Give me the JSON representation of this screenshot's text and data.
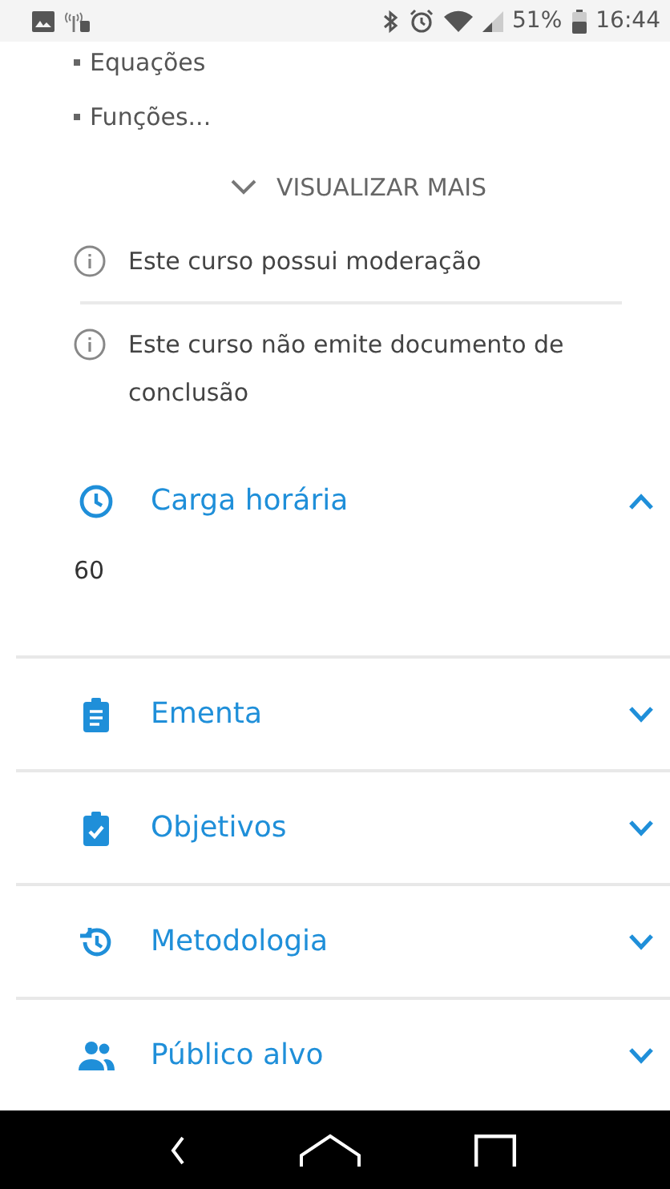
{
  "status_bar": {
    "battery": "51%",
    "time": "16:44"
  },
  "topics": [
    "Equações",
    "Funções..."
  ],
  "show_more": {
    "label": "VISUALIZAR MAIS"
  },
  "notices": [
    "Este curso possui moderação",
    "Este curso não emite documento de conclusão"
  ],
  "sections": [
    {
      "title": "Carga horária",
      "expanded": true,
      "content": "60"
    },
    {
      "title": "Ementa",
      "expanded": false
    },
    {
      "title": "Objetivos",
      "expanded": false
    },
    {
      "title": "Metodologia",
      "expanded": false
    },
    {
      "title": "Público alvo",
      "expanded": false
    }
  ]
}
